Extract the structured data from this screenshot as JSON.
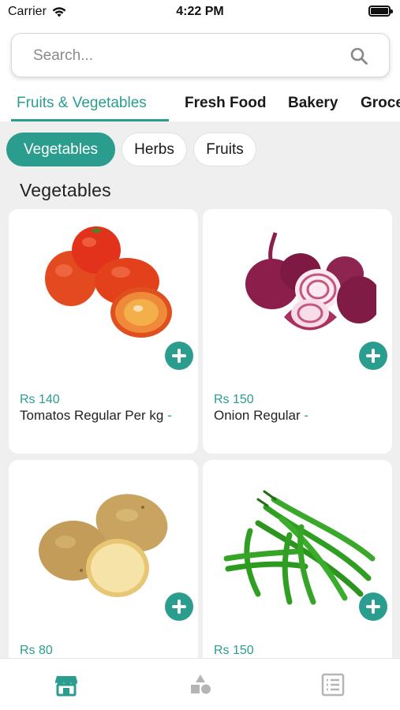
{
  "status_bar": {
    "carrier": "Carrier",
    "time": "4:22 PM"
  },
  "search": {
    "placeholder": "Search..."
  },
  "categories": [
    {
      "label": "Fruits  & Vegetables",
      "active": true
    },
    {
      "label": "Fresh Food",
      "active": false
    },
    {
      "label": "Bakery",
      "active": false
    },
    {
      "label": "Groce",
      "active": false
    }
  ],
  "subcategories": [
    {
      "label": "Vegetables",
      "active": true
    },
    {
      "label": "Herbs",
      "active": false
    },
    {
      "label": "Fruits",
      "active": false
    }
  ],
  "section_title": "Vegetables",
  "products": [
    {
      "price": "Rs 140",
      "name": "Tomatos Regular Per kg",
      "suffix": "-",
      "image_icon": "tomato-image"
    },
    {
      "price": "Rs 150",
      "name": "Onion Regular",
      "suffix": "-",
      "image_icon": "onion-image"
    },
    {
      "price": "Rs 80",
      "name": "",
      "suffix": "",
      "image_icon": "potato-image"
    },
    {
      "price": "Rs 150",
      "name": "",
      "suffix": "",
      "image_icon": "green-chili-image"
    }
  ],
  "bottom_nav": [
    {
      "icon": "store-icon",
      "active": true
    },
    {
      "icon": "categories-icon",
      "active": false
    },
    {
      "icon": "list-icon",
      "active": false
    }
  ],
  "colors": {
    "accent": "#2a9d8f",
    "background": "#efefef",
    "inactive": "#b5b5b5"
  }
}
